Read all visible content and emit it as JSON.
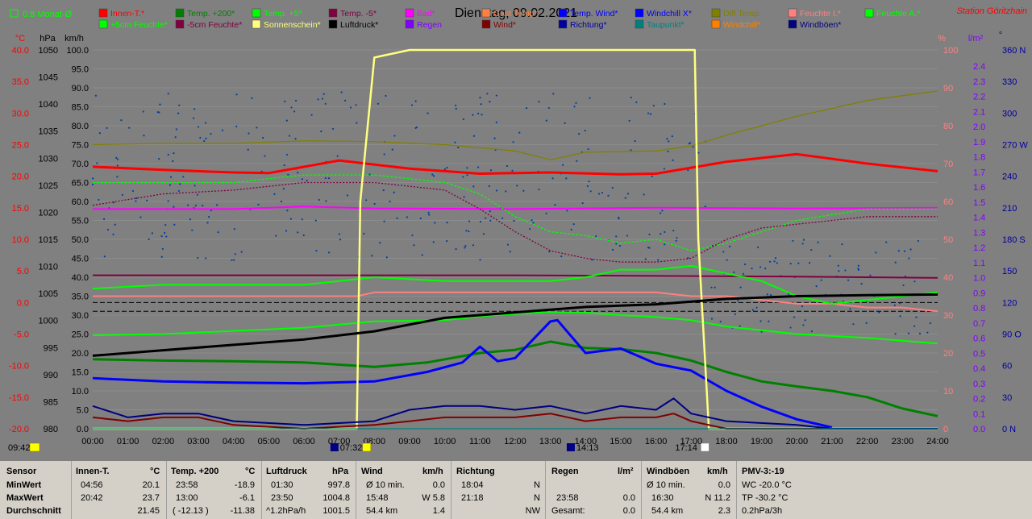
{
  "title": "Dienstag, 09.02.2021",
  "station": "Station Göritzhain",
  "monat_label": "0.8 Monat-Ø",
  "axes": {
    "c_unit": "°C",
    "hpa_unit": "hPa",
    "kmh_unit": "km/h",
    "pct_unit": "%",
    "lm2_unit": "l/m²",
    "deg_unit": "°",
    "c_ticks": [
      "40.0",
      "35.0",
      "30.0",
      "25.0",
      "20.0",
      "15.0",
      "10.0",
      "5.0",
      "0.0",
      "-5.0",
      "-10.0",
      "-15.0",
      "-20.0"
    ],
    "hpa_ticks": [
      "1050",
      "1045",
      "1040",
      "1035",
      "1030",
      "1025",
      "1020",
      "1015",
      "1010",
      "1005",
      "1000",
      "995",
      "990",
      "985",
      "980"
    ],
    "kmh_ticks": [
      "100.0",
      "95.0",
      "90.0",
      "85.0",
      "80.0",
      "75.0",
      "70.0",
      "65.0",
      "60.0",
      "55.0",
      "50.0",
      "45.0",
      "40.0",
      "35.0",
      "30.0",
      "25.0",
      "20.0",
      "15.0",
      "10.0",
      "5.0",
      "0.0"
    ],
    "pct_ticks": [
      "100",
      "90",
      "80",
      "70",
      "60",
      "50",
      "40",
      "30",
      "20",
      "10",
      "0"
    ],
    "lm2_ticks": [
      "2.4",
      "2.3",
      "2.2",
      "2.1",
      "2.0",
      "1.9",
      "1.8",
      "1.7",
      "1.6",
      "1.5",
      "1.4",
      "1.3",
      "1.2",
      "1.1",
      "1.0",
      "0.9",
      "0.8",
      "0.7",
      "0.6",
      "0.5",
      "0.4",
      "0.3",
      "0.2",
      "0.1",
      "0.0"
    ],
    "deg_ticks": [
      "360 N",
      "330",
      "300",
      "270 W",
      "240",
      "210",
      "180 S",
      "150",
      "120",
      "90 O",
      "60",
      "30",
      "0 N"
    ],
    "time_ticks": [
      "00:00",
      "01:00",
      "02:00",
      "03:00",
      "04:00",
      "05:00",
      "06:00",
      "07:00",
      "08:00",
      "09:00",
      "10:00",
      "11:00",
      "12:00",
      "13:00",
      "14:00",
      "15:00",
      "16:00",
      "17:00",
      "18:00",
      "19:00",
      "20:00",
      "21:00",
      "22:00",
      "23:00",
      "24:00"
    ]
  },
  "legend": [
    {
      "label": "Innen-T.*",
      "color": "#ff0000"
    },
    {
      "label": "Temp. +200*",
      "color": "#008000"
    },
    {
      "label": "Temp. +5*",
      "color": "#00ff00"
    },
    {
      "label": "Temp. -5*",
      "color": "#800040"
    },
    {
      "label": "Bad*",
      "color": "#ff00ff"
    },
    {
      "label": "Gast Temp*",
      "color": "#ff8040"
    },
    {
      "label": "Temp. Wind*",
      "color": "#0000ff"
    },
    {
      "label": "Windchill X*",
      "color": "#0000ff"
    },
    {
      "label": "Diff Temp.",
      "color": "#808000"
    },
    {
      "label": "Feuchte I.*",
      "color": "#ff8080"
    },
    {
      "label": "Feuchte A.*",
      "color": "#00ff00"
    },
    {
      "label": "+5cm Feuchte*",
      "color": "#00ff00"
    },
    {
      "label": "-5cm Feuchte*",
      "color": "#800040"
    },
    {
      "label": "Sonnenschein*",
      "color": "#ffff80"
    },
    {
      "label": "Luftdruck*",
      "color": "#000000"
    },
    {
      "label": "Regen",
      "color": "#8000ff"
    },
    {
      "label": "Wind*",
      "color": "#800000"
    },
    {
      "label": "Richtung*",
      "color": "#0000a0"
    },
    {
      "label": "Taupunkt*",
      "color": "#008080"
    },
    {
      "label": "Windchill*",
      "color": "#ff8000"
    },
    {
      "label": "Windböen*",
      "color": "#000080"
    }
  ],
  "sun": {
    "left_label": "09:42",
    "rise": "07:32",
    "noon": "14:13",
    "set": "17:14"
  },
  "chart_data": {
    "type": "line",
    "title": "Dienstag, 09.02.2021",
    "x_unit": "hours",
    "xlim": [
      0,
      24
    ],
    "series": [
      {
        "name": "Innen-T.*",
        "axis": "°C",
        "color": "#ff0000",
        "x": [
          0,
          2,
          4,
          5,
          7,
          9,
          11,
          13,
          15,
          16,
          18,
          20,
          22,
          24
        ],
        "y": [
          21.5,
          21.0,
          20.6,
          20.5,
          22.5,
          21.2,
          20.4,
          20.6,
          20.3,
          20.4,
          22.3,
          23.5,
          22.0,
          20.8
        ]
      },
      {
        "name": "Temp. +200*",
        "axis": "°C",
        "color": "#008000",
        "x": [
          0,
          2,
          4,
          6,
          8,
          9.5,
          11,
          12,
          13,
          14,
          15,
          16,
          17,
          18,
          19,
          20,
          21,
          22,
          23,
          24
        ],
        "y": [
          -9.0,
          -9.2,
          -9.3,
          -9.5,
          -10.2,
          -9.5,
          -8.0,
          -7.5,
          -6.2,
          -7.2,
          -7.4,
          -8.0,
          -9.2,
          -11.0,
          -12.5,
          -13.3,
          -14.0,
          -15.0,
          -16.8,
          -18.0
        ]
      },
      {
        "name": "Temp. +5*",
        "axis": "°C",
        "color": "#00ff00",
        "x": [
          0,
          2,
          4,
          6,
          8,
          10,
          11,
          12,
          13,
          14,
          15,
          16,
          17,
          18,
          20,
          22,
          24
        ],
        "y": [
          -5.2,
          -5.0,
          -4.5,
          -4.0,
          -3.0,
          -2.8,
          -2.2,
          -1.8,
          -1.5,
          -1.6,
          -2.0,
          -2.3,
          -2.8,
          -3.8,
          -5.0,
          -5.6,
          -6.5
        ]
      },
      {
        "name": "Temp. -5*",
        "axis": "°C",
        "color": "#800040",
        "x": [
          0,
          4,
          8,
          12,
          16,
          20,
          24
        ],
        "y": [
          4.3,
          4.3,
          4.3,
          4.3,
          4.2,
          4.1,
          3.9
        ]
      },
      {
        "name": "Bad*",
        "axis": "°C",
        "color": "#ff00ff",
        "x": [
          0,
          4,
          6,
          8,
          12,
          16,
          20,
          24
        ],
        "y": [
          14.8,
          14.8,
          15.2,
          14.9,
          14.8,
          15.0,
          14.9,
          15.0
        ]
      },
      {
        "name": "Temp. Wind*",
        "axis": "°C",
        "color": "#0000ff",
        "x": [
          0,
          2,
          4,
          6,
          8,
          9.5,
          10.5,
          11,
          11.5,
          12,
          13,
          13.2,
          14,
          15,
          16,
          17,
          18,
          19,
          20,
          21
        ],
        "y": [
          -12.0,
          -12.5,
          -12.7,
          -12.8,
          -12.5,
          -11.0,
          -9.5,
          -7.0,
          -9.3,
          -8.8,
          -3.0,
          -2.8,
          -8.0,
          -7.3,
          -9.7,
          -10.8,
          -14.0,
          -16.5,
          -18.5,
          -19.8
        ]
      },
      {
        "name": "Diff Temp.",
        "axis": "°C",
        "color": "#808000",
        "x": [
          0,
          2,
          4,
          6,
          8,
          10,
          12,
          13,
          14,
          16,
          17,
          18,
          20,
          22,
          24
        ],
        "y": [
          25.0,
          25.2,
          25.2,
          25.6,
          25.5,
          25.0,
          24.0,
          22.6,
          23.8,
          24.0,
          24.8,
          26.5,
          29.5,
          32.0,
          33.5
        ]
      },
      {
        "name": "Feuchte I.*",
        "axis": "%",
        "color": "#ff8080",
        "x": [
          0,
          2,
          4,
          6,
          7.5,
          8,
          12,
          16,
          17,
          18,
          19,
          20,
          21,
          22,
          23,
          24
        ],
        "y": [
          35,
          35,
          35,
          35,
          35,
          36,
          36,
          36,
          35,
          35,
          34,
          33,
          33,
          32,
          32,
          31
        ]
      },
      {
        "name": "Feuchte A.*",
        "axis": "%",
        "color": "#00ff00",
        "x": [
          0,
          2,
          4,
          6,
          8,
          10,
          12,
          13,
          14,
          15,
          16,
          17,
          18,
          19,
          20,
          21,
          22,
          23,
          24
        ],
        "y": [
          37,
          38,
          38,
          38,
          40,
          39,
          39,
          39,
          40,
          42,
          42,
          43,
          41,
          39,
          35,
          33,
          34,
          35,
          36
        ]
      },
      {
        "name": "+5cm Feuchte*",
        "axis": "%",
        "color": "#00ff00",
        "x": [
          0,
          4,
          6,
          8,
          10,
          11,
          12,
          13,
          14,
          15,
          16,
          17,
          18,
          20,
          22,
          24
        ],
        "y": [
          65,
          65,
          67,
          67,
          65,
          62,
          56,
          52,
          51,
          49,
          50,
          47,
          49,
          55,
          58,
          58
        ]
      },
      {
        "name": "-5cm Feuchte*",
        "axis": "%",
        "color": "#800040",
        "x": [
          0,
          2,
          4,
          6,
          8,
          10,
          11,
          12,
          13,
          14,
          15,
          16,
          17,
          18,
          19,
          20,
          22,
          24
        ],
        "y": [
          59,
          62,
          63,
          65,
          65,
          63,
          58,
          52,
          47,
          45,
          44,
          44,
          45,
          50,
          53,
          54,
          56,
          56
        ]
      },
      {
        "name": "Sonnenschein*",
        "axis": "%",
        "color": "#ffff80",
        "x": [
          0,
          7.5,
          7.6,
          8,
          9,
          17.1,
          17.2,
          17.5,
          24
        ],
        "y": [
          0,
          0,
          60,
          98,
          100,
          100,
          50,
          0,
          0
        ]
      },
      {
        "name": "Luftdruck*",
        "axis": "hPa",
        "color": "#000000",
        "x": [
          0,
          2,
          4,
          6,
          8,
          10,
          12,
          13,
          14,
          16,
          17,
          18,
          20,
          22,
          24
        ],
        "y": [
          993.5,
          994.5,
          995.5,
          996.5,
          998.0,
          1000.5,
          1001.5,
          1002.0,
          1002.5,
          1003.0,
          1003.5,
          1004.0,
          1004.5,
          1004.7,
          1004.8
        ]
      },
      {
        "name": "Wind*",
        "axis": "km/h",
        "color": "#800000",
        "x": [
          0,
          1,
          2,
          3,
          4,
          6,
          8,
          9,
          10,
          11,
          12,
          13,
          14,
          15,
          16,
          16.5,
          17,
          18,
          20,
          24
        ],
        "y": [
          3,
          2,
          3,
          3,
          1,
          0,
          1,
          2,
          3,
          3,
          3,
          4,
          2,
          3,
          3,
          4,
          2,
          0,
          0,
          0
        ]
      },
      {
        "name": "Windböen*",
        "axis": "km/h",
        "color": "#000080",
        "x": [
          0,
          1,
          2,
          3,
          4,
          6,
          8,
          9,
          10,
          11,
          12,
          13,
          14,
          15,
          16,
          16.5,
          17,
          18,
          20,
          21,
          24
        ],
        "y": [
          6,
          3,
          4,
          4,
          2,
          1,
          2,
          5,
          6,
          6,
          5,
          6,
          4,
          6,
          5,
          8,
          4,
          2,
          1,
          0,
          0
        ]
      },
      {
        "name": "Taupunkt*",
        "axis": "°C",
        "color": "#008080",
        "x": [
          0,
          4,
          8,
          12,
          16,
          24
        ],
        "y": [
          -20,
          -20,
          -20,
          -20,
          -20,
          -20
        ]
      }
    ],
    "ylim_c": [
      -20,
      40
    ],
    "ylim_hpa": [
      980,
      1050
    ],
    "ylim_kmh": [
      0,
      100
    ],
    "ylim_pct": [
      0,
      100
    ]
  },
  "stats": {
    "sensor_header": "Sensor",
    "min_label": "MinWert",
    "max_label": "MaxWert",
    "avg_label": "Durchschnitt",
    "innen": {
      "header": "Innen-T.",
      "unit": "°C",
      "min_time": "04:56",
      "min_val": "20.1",
      "max_time": "20:42",
      "max_val": "23.7",
      "avg_val": "21.45"
    },
    "temp": {
      "header": "Temp. +200",
      "unit": "°C",
      "min_time": "23:58",
      "min_val": "-18.9",
      "max_time": "13:00",
      "max_val": "-6.1",
      "avg_extra": "( -12.13 )",
      "avg_val": "-11.38"
    },
    "luft": {
      "header": "Luftdruck",
      "unit": "hPa",
      "min_time": "01:30",
      "min_val": "997.8",
      "max_time": "23:50",
      "max_val": "1004.8",
      "avg_extra": "^1.2hPa/h",
      "avg_val": "1001.5"
    },
    "wind": {
      "header": "Wind",
      "unit": "km/h",
      "min_time": "Ø 10 min.",
      "min_val": "0.0",
      "max_time": "15:48",
      "max_val": "W 5.8",
      "avg_extra": "54.4 km",
      "avg_val": "1.4"
    },
    "richtung": {
      "header": "Richtung",
      "min_time": "18:04",
      "min_val": "N",
      "max_time": "21:18",
      "max_val": "N",
      "avg_val": "NW"
    },
    "regen": {
      "header": "Regen",
      "unit": "l/m²",
      "max_time": "23:58",
      "max_val": "0.0",
      "avg_extra": "Gesamt:",
      "avg_val": "0.0"
    },
    "boen": {
      "header": "Windböen",
      "unit": "km/h",
      "min_time": "Ø 10 min.",
      "min_val": "0.0",
      "max_time": "16:30",
      "max_val": "N 11.2",
      "avg_extra": "54.4 km",
      "avg_val": "2.3"
    },
    "pmv": {
      "header": "PMV-3:-19",
      "l1": "WC -20.0 °C",
      "l2": "TP -30.2 °C",
      "l3": "0.2hPa/3h"
    }
  }
}
